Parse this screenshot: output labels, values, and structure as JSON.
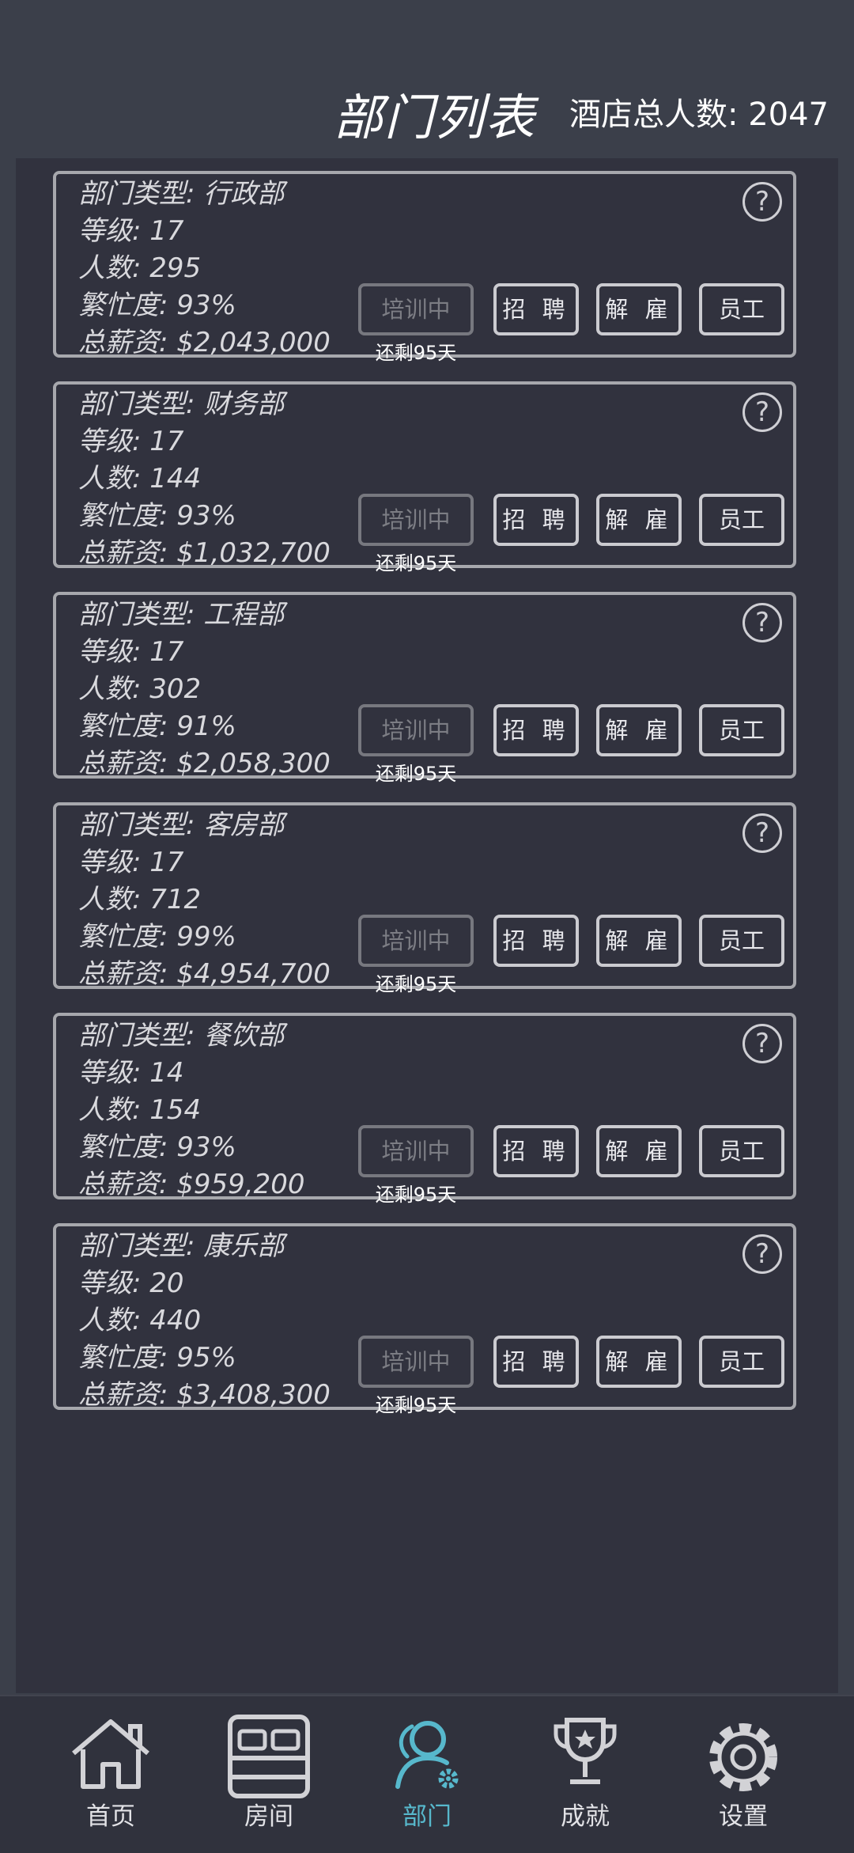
{
  "header": {
    "title": "部门列表",
    "staff_total": "酒店总人数: 2047"
  },
  "buttons": {
    "train": "培训中",
    "hire": "招 聘",
    "fire": "解 雇",
    "staff": "员工",
    "help": "?"
  },
  "departments": [
    {
      "type": "部门类型: 行政部",
      "level": "等级: 17",
      "count": "人数: 295",
      "busy": "繁忙度: 93%",
      "salary": "总薪资: $2,043,000",
      "remaining": "还剩95天"
    },
    {
      "type": "部门类型: 财务部",
      "level": "等级: 17",
      "count": "人数: 144",
      "busy": "繁忙度: 93%",
      "salary": "总薪资: $1,032,700",
      "remaining": "还剩95天"
    },
    {
      "type": "部门类型: 工程部",
      "level": "等级: 17",
      "count": "人数: 302",
      "busy": "繁忙度: 91%",
      "salary": "总薪资: $2,058,300",
      "remaining": "还剩95天"
    },
    {
      "type": "部门类型: 客房部",
      "level": "等级: 17",
      "count": "人数: 712",
      "busy": "繁忙度: 99%",
      "salary": "总薪资: $4,954,700",
      "remaining": "还剩95天"
    },
    {
      "type": "部门类型: 餐饮部",
      "level": "等级: 14",
      "count": "人数: 154",
      "busy": "繁忙度: 93%",
      "salary": "总薪资: $959,200",
      "remaining": "还剩95天"
    },
    {
      "type": "部门类型: 康乐部",
      "level": "等级: 20",
      "count": "人数: 440",
      "busy": "繁忙度: 95%",
      "salary": "总薪资: $3,408,300",
      "remaining": "还剩95天"
    }
  ],
  "nav": {
    "items": [
      {
        "label": "首页",
        "icon": "home-icon"
      },
      {
        "label": "房间",
        "icon": "bed-icon"
      },
      {
        "label": "部门",
        "icon": "department-icon",
        "active": true
      },
      {
        "label": "成就",
        "icon": "trophy-icon"
      },
      {
        "label": "设置",
        "icon": "gear-icon"
      }
    ],
    "active_color": "#57b8cc"
  }
}
